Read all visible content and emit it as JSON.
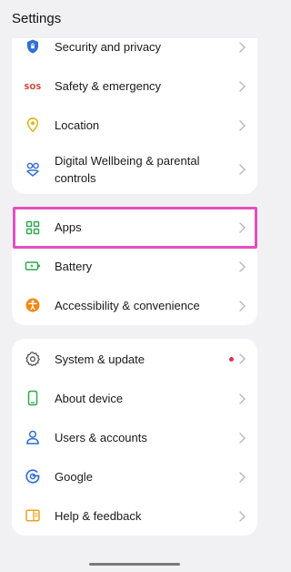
{
  "header": {
    "title": "Settings"
  },
  "groups": [
    {
      "items": [
        {
          "label": "Security and privacy",
          "icon": "shield-icon"
        },
        {
          "label": "Safety & emergency",
          "icon": "sos-icon",
          "icon_text": "SOS"
        },
        {
          "label": "Location",
          "icon": "location-pin-icon"
        },
        {
          "label": "Digital Wellbeing & parental controls",
          "icon": "wellbeing-icon"
        }
      ]
    },
    {
      "items": [
        {
          "label": "Apps",
          "icon": "apps-grid-icon",
          "highlighted": true
        },
        {
          "label": "Battery",
          "icon": "battery-icon"
        },
        {
          "label": "Accessibility & convenience",
          "icon": "accessibility-icon"
        }
      ]
    },
    {
      "items": [
        {
          "label": "System & update",
          "icon": "gear-icon",
          "has_notification_dot": true
        },
        {
          "label": "About device",
          "icon": "phone-icon"
        },
        {
          "label": "Users & accounts",
          "icon": "user-icon"
        },
        {
          "label": "Google",
          "icon": "google-icon"
        },
        {
          "label": "Help & feedback",
          "icon": "help-icon"
        }
      ]
    }
  ],
  "colors": {
    "background": "#f1f1f3",
    "card": "#ffffff",
    "highlight": "#e44fc0",
    "notification_dot": "#d83450",
    "security_blue": "#2f6fd6",
    "sos_red": "#d9352b",
    "location_yellow": "#e5b31a",
    "wellbeing_blue": "#3a6fd1",
    "apps_green": "#2fa84f",
    "battery_green": "#2fa84f",
    "accessibility_orange": "#f08a10",
    "system_gray": "#555555",
    "about_green": "#2fa84f",
    "users_blue": "#2f6fd6",
    "google_blue": "#2f6fd6",
    "help_orange": "#f0a020"
  }
}
